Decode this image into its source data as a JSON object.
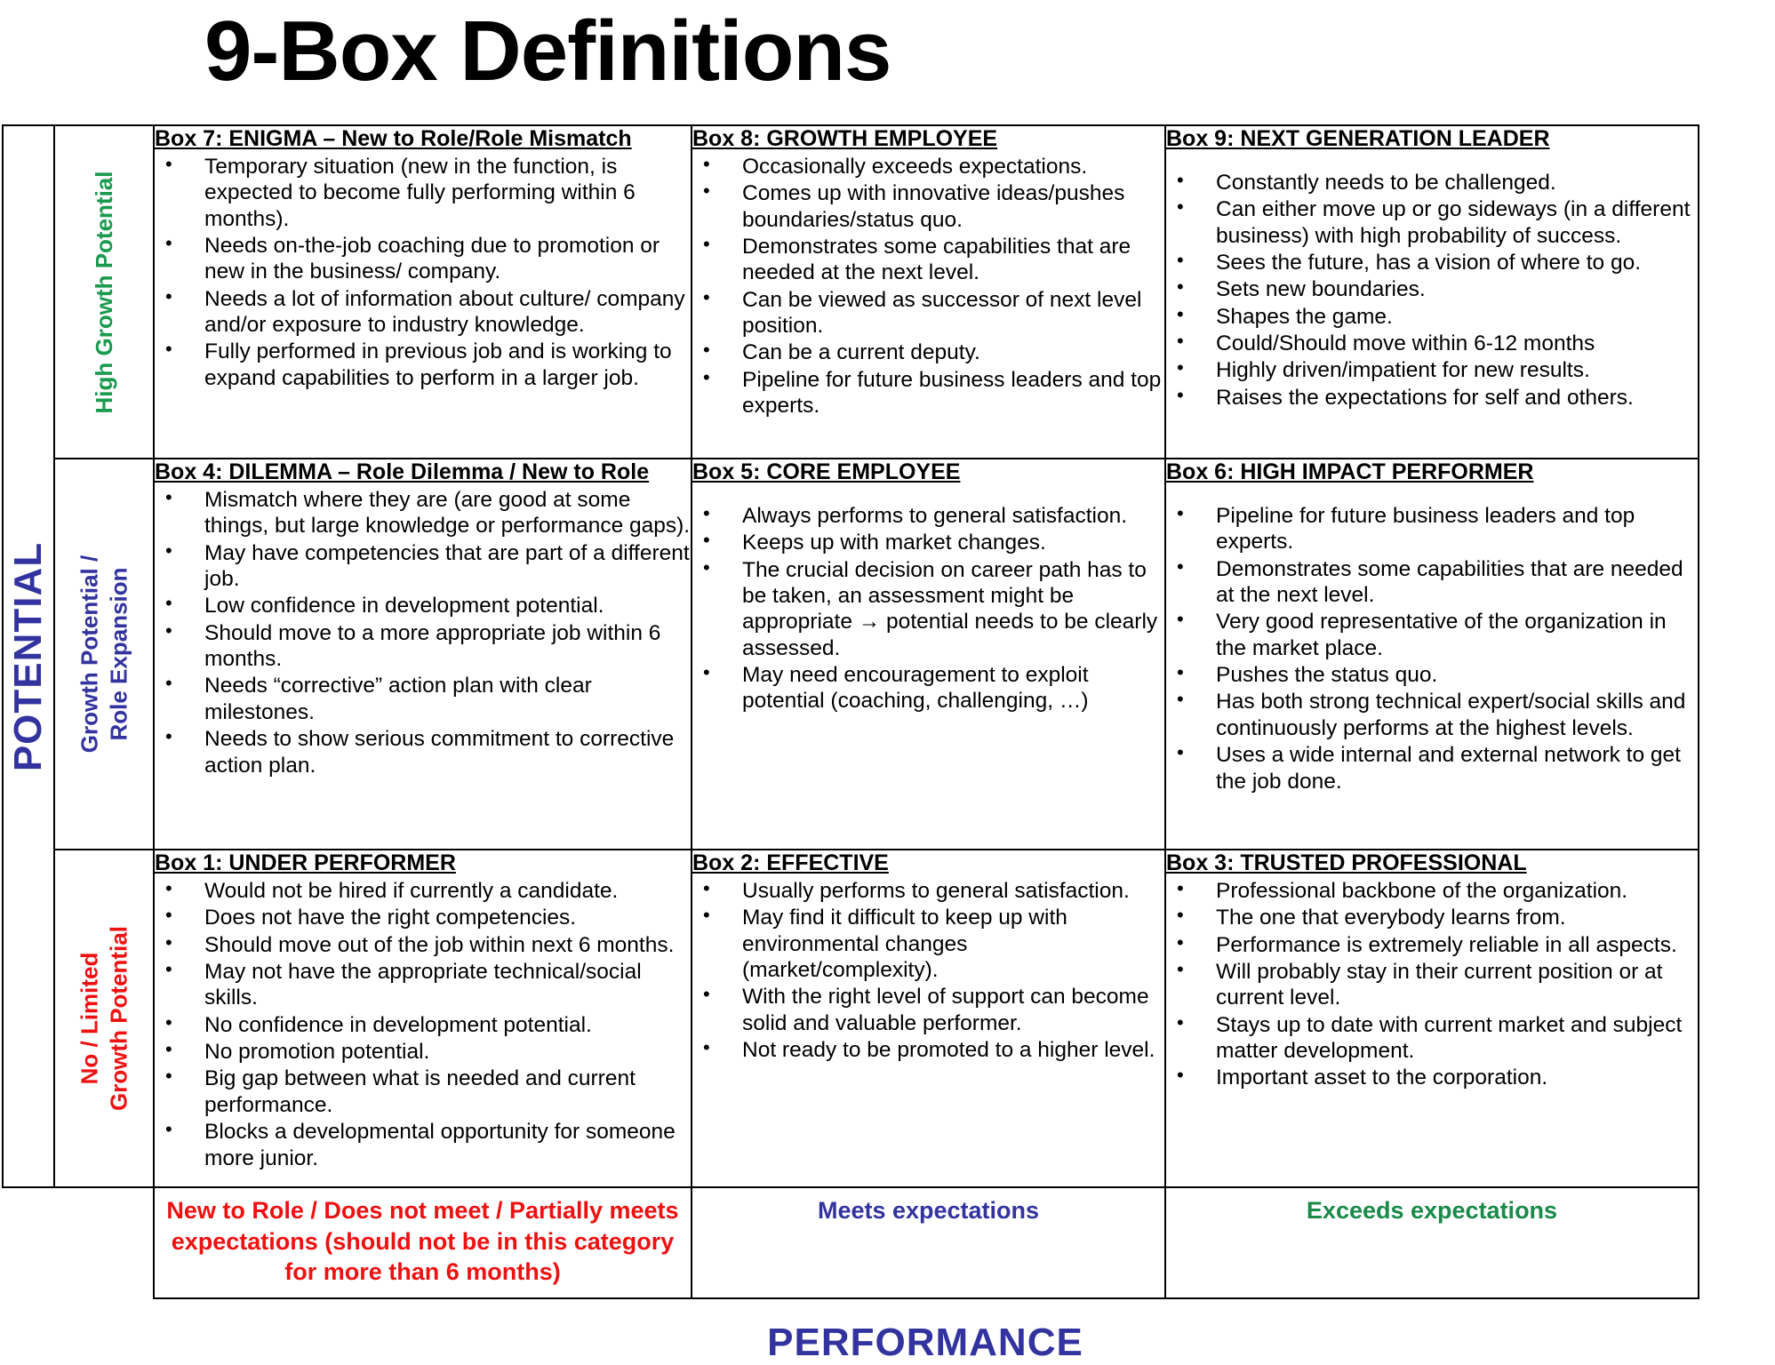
{
  "title": "9-Box Definitions",
  "axes": {
    "potential": "POTENTIAL",
    "performance": "PERFORMANCE"
  },
  "colors": {
    "green": "#1a9a4e",
    "blue": "#3333a0",
    "red": "#ee1111"
  },
  "rows": [
    {
      "label": "High Growth Potential",
      "color": "green",
      "boxes": [
        {
          "title": "Box 7: ENIGMA – New to Role/Role Mismatch",
          "bullets": [
            "Temporary situation (new in the function, is expected to become fully performing within 6 months).",
            "Needs on-the-job coaching due to promotion or new in the business/ company.",
            "Needs a lot of information about culture/ company and/or exposure to industry knowledge.",
            "Fully performed in previous job and is working to expand capabilities to perform in a larger job."
          ]
        },
        {
          "title": "Box 8: GROWTH EMPLOYEE",
          "bullets": [
            "Occasionally exceeds expectations.",
            "Comes up with innovative ideas/pushes boundaries/status quo.",
            "Demonstrates some capabilities that are needed at the next level.",
            "Can be viewed as successor of next level position.",
            "Can be a current deputy.",
            "Pipeline for future business leaders and top experts."
          ]
        },
        {
          "title": "Box 9: NEXT GENERATION LEADER",
          "lead_gap": true,
          "bullets": [
            "Constantly needs to be challenged.",
            "Can either move up or go sideways (in a different business) with high probability of success.",
            "Sees the future, has a vision of where to go.",
            "Sets new boundaries.",
            "Shapes the game.",
            "Could/Should move within 6-12 months",
            "Highly driven/impatient for new results.",
            "Raises the expectations for self and others."
          ]
        }
      ]
    },
    {
      "label": "Growth  Potential /\nRole Expansion",
      "color": "blue",
      "boxes": [
        {
          "title": "Box 4: DILEMMA – Role Dilemma / New to Role",
          "bullets": [
            "Mismatch where they are (are good at some things, but large knowledge or performance gaps).",
            "May have competencies that are part of a different job.",
            "Low confidence in development potential.",
            "Should move to a more appropriate job within 6 months.",
            "Needs “corrective” action plan with clear milestones.",
            "Needs to show serious commitment to corrective action plan."
          ]
        },
        {
          "title": "Box 5: CORE EMPLOYEE",
          "lead_gap": true,
          "bullets": [
            "Always performs to general satisfaction.",
            "Keeps up with market changes.",
            "The crucial decision on career path has to be taken, an assessment might be appropriate → potential needs to be clearly assessed.",
            "May need encouragement to exploit potential (coaching, challenging, …)"
          ]
        },
        {
          "title": "Box 6: HIGH IMPACT PERFORMER",
          "lead_gap": true,
          "bullets": [
            "Pipeline for future business leaders and top experts.",
            "Demonstrates some capabilities that are needed at the next level.",
            "Very good representative of the organization in the market place.",
            "Pushes the status quo.",
            "Has both strong technical expert/social skills and continuously performs at the highest levels.",
            "Uses a wide internal and external network to get the job done."
          ]
        }
      ]
    },
    {
      "label": "No / Limited\nGrowth Potential",
      "color": "red",
      "boxes": [
        {
          "title": "Box 1: UNDER PERFORMER",
          "bullets": [
            "Would not be hired if currently a candidate.",
            "Does not have the right competencies.",
            "Should move out of the job within next 6 months.",
            "May not have the appropriate technical/social skills.",
            "No confidence in development potential.",
            "No promotion potential.",
            "Big gap between what is needed and current performance.",
            "Blocks a developmental opportunity for someone more junior."
          ]
        },
        {
          "title": "Box 2: EFFECTIVE",
          "bullets": [
            "Usually performs to general satisfaction.",
            "May find it difficult to keep up with environmental changes (market/complexity).",
            "With the right level of support can become solid and valuable performer.",
            "Not ready to be promoted to a higher level."
          ]
        },
        {
          "title": "Box 3: TRUSTED PROFESSIONAL",
          "bullets": [
            "Professional backbone of the organization.",
            "The one that everybody learns from.",
            "Performance is extremely reliable in all aspects.",
            "Will probably stay in their current position or at current level.",
            "Stays up to date with current market and subject matter development.",
            "Important asset to the corporation."
          ]
        }
      ]
    }
  ],
  "performance_levels": [
    {
      "label": "New to Role / Does not meet / Partially meets expectations (should not be in this category\nfor more than 6 months)",
      "color": "red"
    },
    {
      "label": "Meets expectations",
      "color": "blue"
    },
    {
      "label": "Exceeds expectations",
      "color": "green"
    }
  ]
}
